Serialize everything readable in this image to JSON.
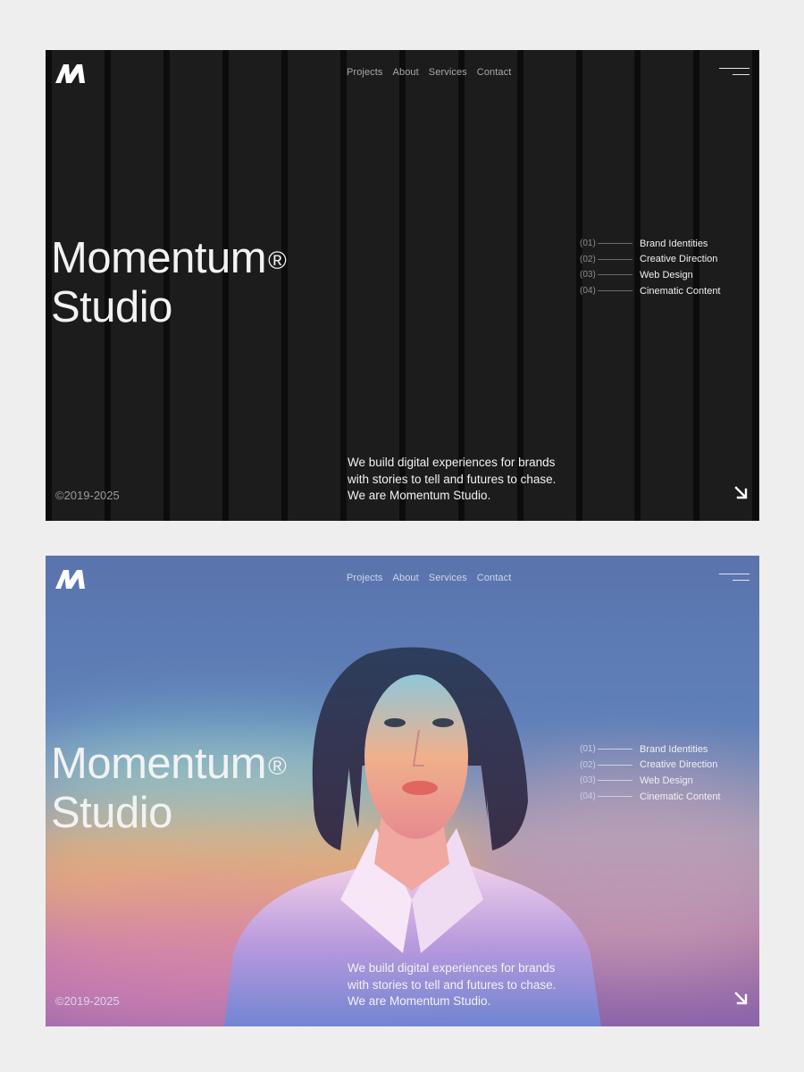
{
  "frames": [
    {
      "variant": "dark",
      "logo": "M",
      "nav": [
        "Projects",
        "About",
        "Services",
        "Contact"
      ],
      "menu_icon": "hamburger-icon",
      "title_line1": "Momentum",
      "registered": "®",
      "title_line2": "Studio",
      "services": [
        {
          "num": "(01)",
          "label": "Brand Identities"
        },
        {
          "num": "(02)",
          "label": "Creative Direction"
        },
        {
          "num": "(03)",
          "label": "Web Design"
        },
        {
          "num": "(04)",
          "label": "Cinematic Content"
        }
      ],
      "tagline": [
        "We build digital experiences for brands",
        "with stories to tell and futures to chase.",
        "We are Momentum Studio."
      ],
      "copyright": "©2019-2025",
      "arrow_icon": "arrow-down-right-icon"
    },
    {
      "variant": "color",
      "logo": "M",
      "nav": [
        "Projects",
        "About",
        "Services",
        "Contact"
      ],
      "menu_icon": "hamburger-icon",
      "title_line1": "Momentum",
      "registered": "®",
      "title_line2": "Studio",
      "services": [
        {
          "num": "(01)",
          "label": "Brand Identities"
        },
        {
          "num": "(02)",
          "label": "Creative Direction"
        },
        {
          "num": "(03)",
          "label": "Web Design"
        },
        {
          "num": "(04)",
          "label": "Cinematic Content"
        }
      ],
      "tagline": [
        "We build digital experiences for brands",
        "with stories to tell and futures to chase.",
        "We are Momentum Studio."
      ],
      "copyright": "©2019-2025",
      "arrow_icon": "arrow-down-right-icon"
    }
  ],
  "colors": {
    "page_bg": "#eeeeee",
    "dark_bg": "#1c1c1c",
    "stripe": "#0c0c0c",
    "text": "#f2f2f2",
    "muted": "#9b9b9b"
  }
}
